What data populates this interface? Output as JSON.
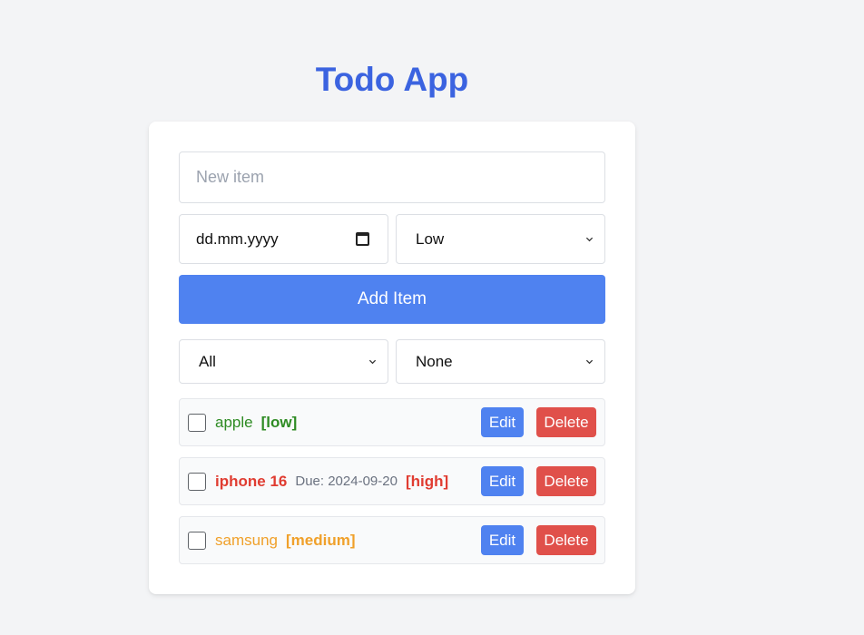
{
  "app": {
    "title": "Todo App",
    "accent_color": "#3b63e0"
  },
  "form": {
    "new_item_placeholder": "New item",
    "new_item_value": "",
    "date_placeholder": "dd.mm.yyyy",
    "priority_selected": "Low",
    "add_button_label": "Add Item",
    "add_button_color": "#4f82f0"
  },
  "filters": {
    "filter_selected": "All",
    "sort_selected": "None"
  },
  "todos": [
    {
      "text": "apple",
      "bold": false,
      "due": "",
      "priority_label": "[low]",
      "color": "#2e8b23",
      "checked": false,
      "edit_label": "Edit",
      "delete_label": "Delete"
    },
    {
      "text": "iphone 16",
      "bold": true,
      "due": "Due: 2024-09-20",
      "priority_label": "[high]",
      "color": "#e03c31",
      "checked": false,
      "edit_label": "Edit",
      "delete_label": "Delete"
    },
    {
      "text": "samsung",
      "bold": false,
      "due": "",
      "priority_label": "[medium]",
      "color": "#f0a02a",
      "checked": false,
      "edit_label": "Edit",
      "delete_label": "Delete"
    }
  ],
  "colors": {
    "edit_button": "#4f82f0",
    "delete_button": "#e0504a"
  },
  "icons": {
    "date_picker": "calendar-icon",
    "select_arrow": "chevron-down-icon"
  }
}
